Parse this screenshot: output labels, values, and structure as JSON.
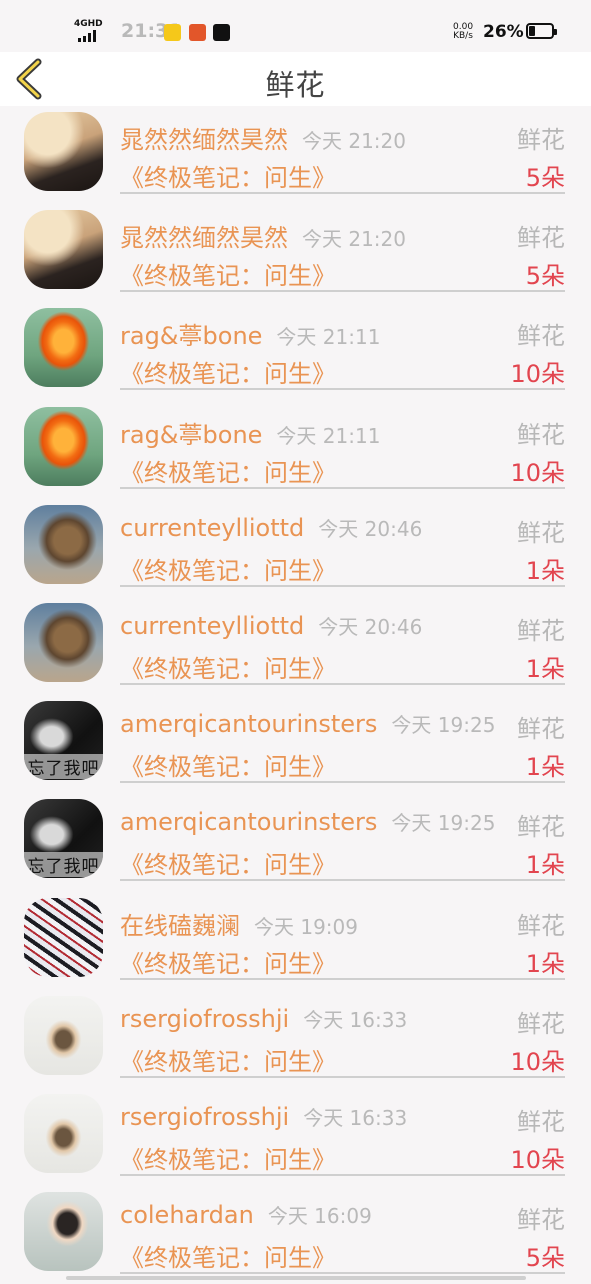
{
  "status_bar": {
    "network": "4GHD",
    "time": "21:31",
    "speed_value": "0.00",
    "speed_unit": "KB/s",
    "battery": "26%"
  },
  "header": {
    "title": "鲜花",
    "back_icon": "chevron-left-icon"
  },
  "colors": {
    "accent": "#e99453",
    "count": "#e2454f",
    "muted": "#b9b9b9"
  },
  "items": [
    {
      "name": "晁然然缅然昊然",
      "time": "今天 21:20",
      "gift": "鲜花",
      "book": "《终极笔记：问生》",
      "count": "5朵",
      "avatar": "city-ruins"
    },
    {
      "name": "晁然然缅然昊然",
      "time": "今天 21:20",
      "gift": "鲜花",
      "book": "《终极笔记：问生》",
      "count": "5朵",
      "avatar": "city-ruins"
    },
    {
      "name": "rag&葶bone",
      "time": "今天 21:11",
      "gift": "鲜花",
      "book": "《终极笔记：问生》",
      "count": "10朵",
      "avatar": "orange-flower"
    },
    {
      "name": "rag&葶bone",
      "time": "今天 21:11",
      "gift": "鲜花",
      "book": "《终极笔记：问生》",
      "count": "10朵",
      "avatar": "orange-flower"
    },
    {
      "name": "currenteylliottd",
      "time": "今天 20:46",
      "gift": "鲜花",
      "book": "《终极笔记：问生》",
      "count": "1朵",
      "avatar": "lion"
    },
    {
      "name": "currenteylliottd",
      "time": "今天 20:46",
      "gift": "鲜花",
      "book": "《终极笔记：问生》",
      "count": "1朵",
      "avatar": "lion"
    },
    {
      "name": "amerqicantourinsters",
      "time": "今天 19:25",
      "gift": "鲜花",
      "book": "《终极笔记：问生》",
      "count": "1朵",
      "avatar": "bw-portrait",
      "avatar_caption": "忘了我吧"
    },
    {
      "name": "amerqicantourinsters",
      "time": "今天 19:25",
      "gift": "鲜花",
      "book": "《终极笔记：问生》",
      "count": "1朵",
      "avatar": "bw-portrait",
      "avatar_caption": "忘了我吧"
    },
    {
      "name": "在线磕巍澜",
      "time": "今天 19:09",
      "gift": "鲜花",
      "book": "《终极笔记：问生》",
      "count": "1朵",
      "avatar": "anime-art"
    },
    {
      "name": "rsergiofrosshji",
      "time": "今天 16:33",
      "gift": "鲜花",
      "book": "《终极笔记：问生》",
      "count": "10朵",
      "avatar": "girl-waving"
    },
    {
      "name": "rsergiofrosshji",
      "time": "今天 16:33",
      "gift": "鲜花",
      "book": "《终极笔记：问生》",
      "count": "10朵",
      "avatar": "girl-waving"
    },
    {
      "name": "colehardan",
      "time": "今天 16:09",
      "gift": "鲜花",
      "book": "《终极笔记：问生》",
      "count": "5朵",
      "avatar": "selfie"
    }
  ]
}
